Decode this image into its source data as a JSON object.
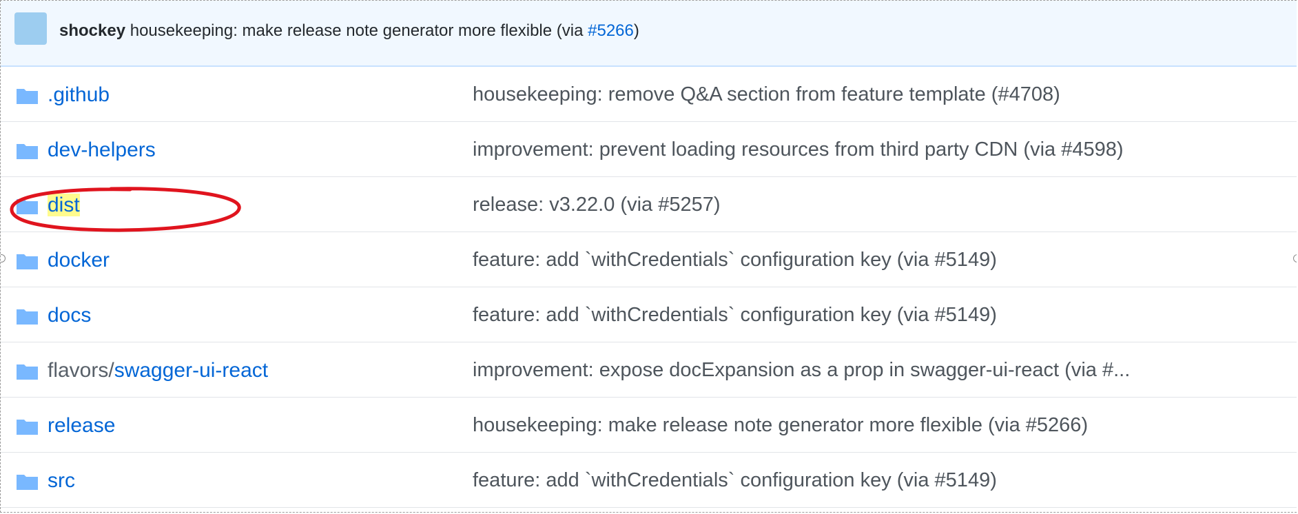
{
  "latest_commit": {
    "author": "shockey",
    "message": "housekeeping: make release note generator more flexible (via ",
    "pr": "#5266",
    "close": ")"
  },
  "files": [
    {
      "prefix": "",
      "name": ".github",
      "message": "housekeeping: remove Q&A section from feature template (#4708)"
    },
    {
      "prefix": "",
      "name": "dev-helpers",
      "message": "improvement: prevent loading resources from third party CDN (via #4598)"
    },
    {
      "prefix": "",
      "name": "dist",
      "message": "release: v3.22.0 (via #5257)"
    },
    {
      "prefix": "",
      "name": "docker",
      "message": "feature: add `withCredentials` configuration key (via #5149)"
    },
    {
      "prefix": "",
      "name": "docs",
      "message": "feature: add `withCredentials` configuration key (via #5149)"
    },
    {
      "prefix": "flavors/",
      "name": "swagger-ui-react",
      "message": "improvement: expose docExpansion as a prop in swagger-ui-react (via #..."
    },
    {
      "prefix": "",
      "name": "release",
      "message": "housekeeping: make release note generator more flexible (via #5266)"
    },
    {
      "prefix": "",
      "name": "src",
      "message": "feature: add `withCredentials` configuration key (via #5149)"
    }
  ],
  "icons": {
    "folder": "folder-icon",
    "avatar": "avatar"
  },
  "colors": {
    "link": "#0366d6",
    "commit_bar": "#f1f8ff",
    "folder": "#79b8ff",
    "annotation": "#e0141e",
    "highlight": "#fffb8f"
  }
}
